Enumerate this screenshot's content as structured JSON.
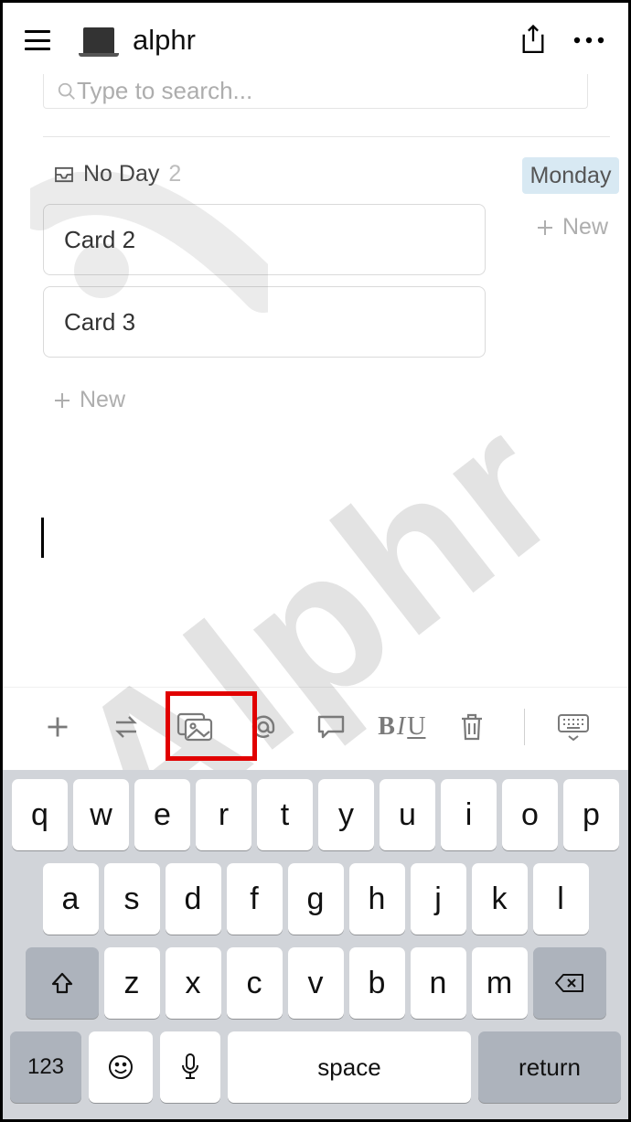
{
  "header": {
    "title": "alphr"
  },
  "search": {
    "placeholder": "Type to search..."
  },
  "board": {
    "columns": [
      {
        "title": "No Day",
        "count": "2",
        "cards": [
          {
            "title": "Card 2"
          },
          {
            "title": "Card 3"
          }
        ],
        "new_label": "New"
      },
      {
        "title": "Monday",
        "new_label": "New"
      }
    ]
  },
  "toolbar": {
    "biu_b": "B",
    "biu_i": "I",
    "biu_u": "U"
  },
  "keyboard": {
    "row1": [
      "q",
      "w",
      "e",
      "r",
      "t",
      "y",
      "u",
      "i",
      "o",
      "p"
    ],
    "row2": [
      "a",
      "s",
      "d",
      "f",
      "g",
      "h",
      "j",
      "k",
      "l"
    ],
    "row3": [
      "z",
      "x",
      "c",
      "v",
      "b",
      "n",
      "m"
    ],
    "numkey": "123",
    "space": "space",
    "return": "return"
  },
  "watermark": "Alphr"
}
